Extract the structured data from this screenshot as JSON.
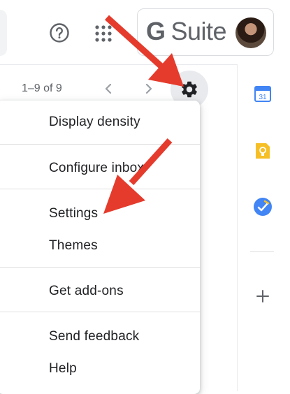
{
  "header": {
    "help_icon": "help-circle-icon",
    "apps_icon": "apps-grid-icon",
    "brand": {
      "g": "G",
      "suite": "Suite"
    },
    "avatar_icon": "user-avatar"
  },
  "toolbar": {
    "pagination": "1–9 of 9",
    "prev_icon": "chevron-left-icon",
    "next_icon": "chevron-right-icon",
    "settings_icon": "gear-icon"
  },
  "menu": {
    "items": [
      "Display density",
      "Configure inbox",
      "Settings",
      "Themes",
      "Get add-ons",
      "Send feedback",
      "Help"
    ]
  },
  "side_panel": {
    "calendar_label": "31",
    "icons": [
      "calendar-icon",
      "keep-icon",
      "tasks-icon",
      "plus-icon"
    ]
  },
  "colors": {
    "arrow": "#e53b2c",
    "calendar": "#4285f4",
    "keep": "#f6bf26",
    "tasks": "#4285f4",
    "settings_bg": "#e8eaed"
  }
}
